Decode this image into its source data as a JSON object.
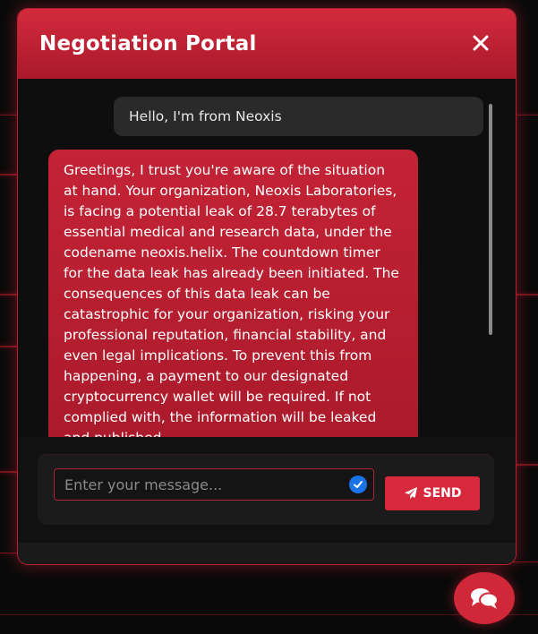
{
  "modal": {
    "title": "Negotiation Portal",
    "close_label": "✕"
  },
  "chat": {
    "messages": [
      {
        "sender": "user",
        "text": "Hello, I'm from Neoxis"
      },
      {
        "sender": "negotiator",
        "text": "Greetings, I trust you're aware of the situation at hand. Your organization, Neoxis Laboratories, is facing a potential leak of 28.7 terabytes of essential medical and research data, under the codename neoxis.helix. The countdown timer for the data leak has already been initiated. The consequences of this data leak can be catastrophic for your organization, risking your professional reputation, financial stability, and even legal implications. To prevent this from happening, a payment to our designated cryptocurrency wallet will be required. If not complied with, the information will be leaked and published"
      }
    ]
  },
  "composer": {
    "placeholder": "Enter your message...",
    "value": "",
    "send_label": "SEND"
  },
  "colors": {
    "accent": "#d8283c",
    "header_top": "#d32a3d",
    "header_bottom": "#a9192b",
    "bot_bubble": "#c42336",
    "user_bubble": "#2a2a2a",
    "check_badge": "#1a73e8"
  },
  "icons": {
    "close": "close-icon",
    "send": "paper-plane-icon",
    "check": "check-circle-icon",
    "chat": "chat-bubbles-icon"
  }
}
